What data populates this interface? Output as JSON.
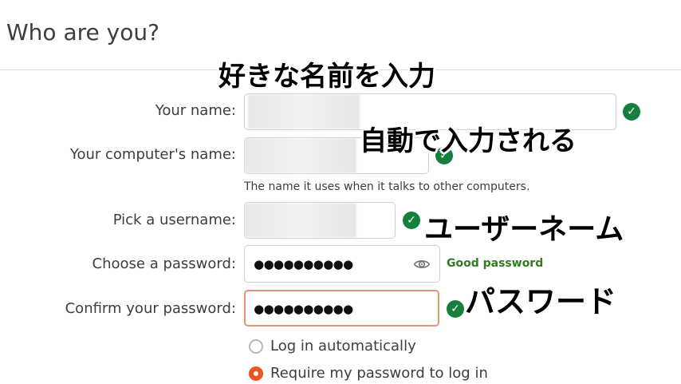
{
  "header": {
    "title": "Who are you?"
  },
  "form": {
    "name_label": "Your name:",
    "computer_label": "Your computer's name:",
    "computer_hint": "The name it uses when it talks to other computers.",
    "username_label": "Pick a username:",
    "password_label": "Choose a password:",
    "password_value": "●●●●●●●●●●",
    "password_strength": "Good password",
    "confirm_label": "Confirm your password:",
    "confirm_value": "●●●●●●●●●●",
    "login_auto": "Log in automatically",
    "login_require": "Require my password to log in"
  },
  "annotations": {
    "name_note": "好きな名前を入力",
    "auto_note": "自動で入力される",
    "username_note": "ユーザーネーム",
    "password_note": "パスワード"
  },
  "colors": {
    "check": "#15803d",
    "accent": "#e95420",
    "focus_border": "#e9927a",
    "strength": "#2f7d1e"
  }
}
